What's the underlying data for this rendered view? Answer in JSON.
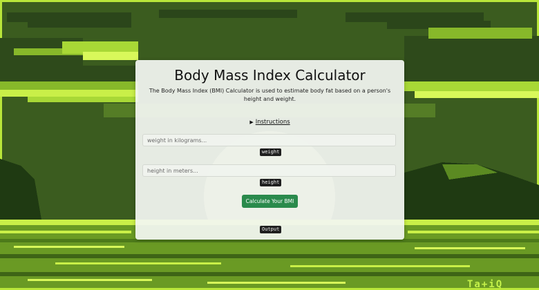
{
  "app": {
    "title": "Body Mass Index Calculator",
    "description": "The Body Mass Index (BMI) Calculator is used to estimate body fat based on a person's height and weight."
  },
  "instructions": {
    "toggle_glyph": "▶",
    "label": "Instructions"
  },
  "inputs": {
    "weight_placeholder": "weight in kilograms...",
    "weight_tag": "weight",
    "height_placeholder": "height in meters...",
    "height_tag": "height"
  },
  "actions": {
    "calculate_label": "Calculate Your BMI"
  },
  "output": {
    "tag": "Output"
  },
  "background": {
    "signature": "Ta+iQ"
  },
  "colors": {
    "button": "#2a8a4c",
    "lime": "#c5f24a",
    "forest": "#3a5a1e"
  }
}
